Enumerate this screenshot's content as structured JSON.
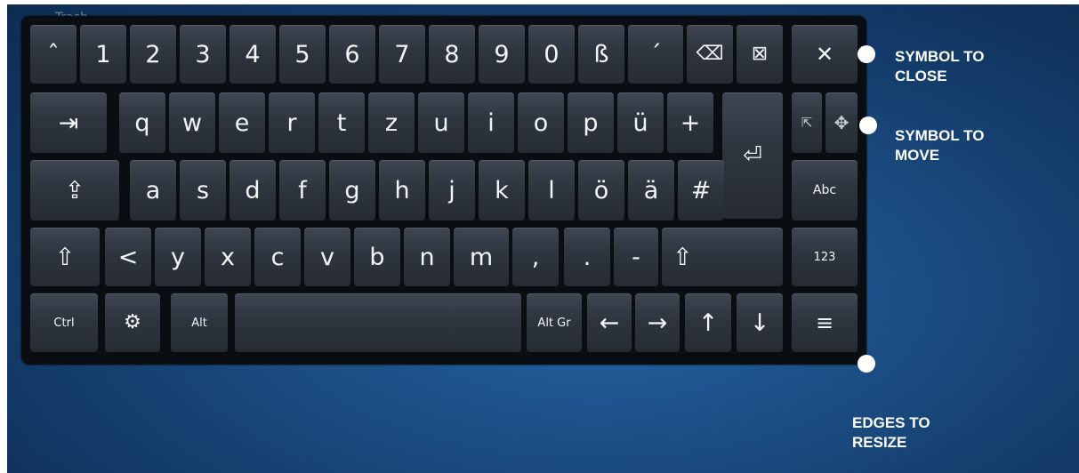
{
  "desktop": {
    "trash_label": "Trash"
  },
  "keyboard": {
    "row1": [
      "ˆ",
      "1",
      "2",
      "3",
      "4",
      "5",
      "6",
      "7",
      "8",
      "9",
      "0",
      "ß",
      "´"
    ],
    "row2": [
      "q",
      "w",
      "e",
      "r",
      "t",
      "z",
      "u",
      "i",
      "o",
      "p",
      "ü",
      "+"
    ],
    "row3": [
      "a",
      "s",
      "d",
      "f",
      "g",
      "h",
      "j",
      "k",
      "l",
      "ö",
      "ä",
      "#"
    ],
    "row4": [
      "<",
      "y",
      "x",
      "c",
      "v",
      "b",
      "n",
      "m",
      ",",
      ".",
      "-"
    ],
    "tab": "⇥",
    "caps": "⇪",
    "shift": "⇧",
    "enter": "⏎",
    "ctrl": "Ctrl",
    "super": "⚙",
    "alt": "Alt",
    "altgr": "Alt Gr",
    "left": "←",
    "right": "→",
    "up": "↑",
    "down": "↓",
    "menu": "≡",
    "backspace": "⌫",
    "delete": "⊠",
    "close": "✕",
    "pointer": "⇱",
    "move": "✥",
    "abc": "Abc",
    "num": "123"
  },
  "annotations": {
    "close": [
      "SYMBOL TO",
      "CLOSE"
    ],
    "move": [
      "SYMBOL TO",
      "MOVE"
    ],
    "resize": [
      "EDGES TO",
      "RESIZE"
    ]
  },
  "colors": {
    "background": "#1c4f86",
    "keyboard": "#0a0d12",
    "key": "#2f353f"
  }
}
